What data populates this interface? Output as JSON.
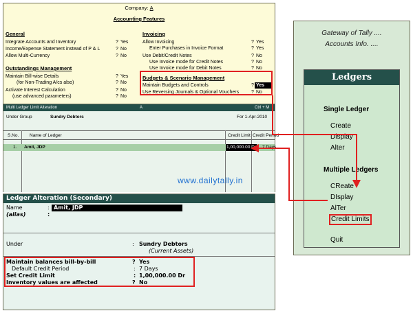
{
  "features": {
    "company_label": "Company",
    "company_value": "A",
    "title": "Accounting Features",
    "general": {
      "heading": "General",
      "rows": [
        {
          "label": "Integrate Accounts and Inventory",
          "value": "Yes"
        },
        {
          "label": "Income/Expense Statement instead of P & L",
          "value": "No"
        },
        {
          "label": "Allow Multi-Currency",
          "value": "No"
        }
      ]
    },
    "outstandings": {
      "heading": "Outstandings Management",
      "rows": [
        {
          "label": "Maintain Bill-wise Details",
          "value": "Yes"
        },
        {
          "label": "(for Non-Trading A/cs also)",
          "value": "No"
        },
        {
          "label": "Activate Interest Calculation",
          "value": "No"
        },
        {
          "label": "(use advanced parameters)",
          "value": "No"
        }
      ]
    },
    "invoicing": {
      "heading": "Invoicing",
      "rows": [
        {
          "label": "Allow Invoicing",
          "value": "Yes"
        },
        {
          "label": "Enter Purchases in Invoice Format",
          "value": "Yes"
        },
        {
          "label": "Use Debit/Credit Notes",
          "value": "No"
        },
        {
          "label": "Use Invoice mode for Credit Notes",
          "value": "No"
        },
        {
          "label": "Use Invoice mode for Debit Notes",
          "value": "No"
        }
      ]
    },
    "budgets": {
      "heading": "Budgets & Scenario Management",
      "rows": [
        {
          "label": "Maintain Budgets and Controls",
          "value": "Yes"
        },
        {
          "label": "Use Reversing Journals & Optional Vouchers",
          "value": "No"
        }
      ]
    },
    "question_mark": "?"
  },
  "multi_ledger": {
    "title": "Multi Ledger Limit  Alteration",
    "company": "A",
    "shortcut": "Ctrl + M",
    "under_group_label": "Under Group",
    "under_group_value": "Sundry Debtors",
    "period": "For 1-Apr-2010",
    "columns": {
      "sno": "S.No.",
      "name": "Name of Ledger",
      "credit_limit": "Credit Limit",
      "credit_period": "Credit Period"
    },
    "rows": [
      {
        "sno": "1.",
        "name": "Amit, JDP",
        "credit_limit": "1,00,000.00 Dr",
        "credit_period": "7 Days"
      }
    ]
  },
  "watermark": "www.dailytally.in",
  "secondary": {
    "title": "Ledger Alteration (Secondary)",
    "name_label": "Name",
    "name_value": "Amit, JDP",
    "alias_label": "(alias)",
    "colon": ":",
    "under_label": "Under",
    "under_value": "Sundry Debtors",
    "under_sub": "(Current Assets)",
    "bill_by_bill_label": "Maintain balances bill-by-bill",
    "bill_by_bill_value": "Yes",
    "credit_period_label": "Default Credit Period",
    "credit_period_value": "7 Days",
    "credit_limit_label": "Set Credit Limit",
    "credit_limit_value": "1,00,000.00 Dr",
    "inventory_label": "Inventory values are affected",
    "inventory_value": "No",
    "question_mark": "?"
  },
  "gateway": {
    "line1": "Gateway of Tally ....",
    "line2": "Accounts Info. ....",
    "ledgers_title": "Ledgers",
    "single_heading": "Single Ledger",
    "single_items": [
      "Create",
      "Display",
      "Alter"
    ],
    "multiple_heading": "Multiple Ledgers",
    "multiple_items": [
      "CReate",
      "DIsplay",
      "AlTer",
      "Credit Limits"
    ],
    "quit": "Quit"
  },
  "colors": {
    "accent_red": "#e02020",
    "title_bar": "#24504a",
    "features_bg": "#fdfbd8",
    "menu_bg": "#cfe8cf",
    "watermark_blue": "#1e6fd0"
  }
}
